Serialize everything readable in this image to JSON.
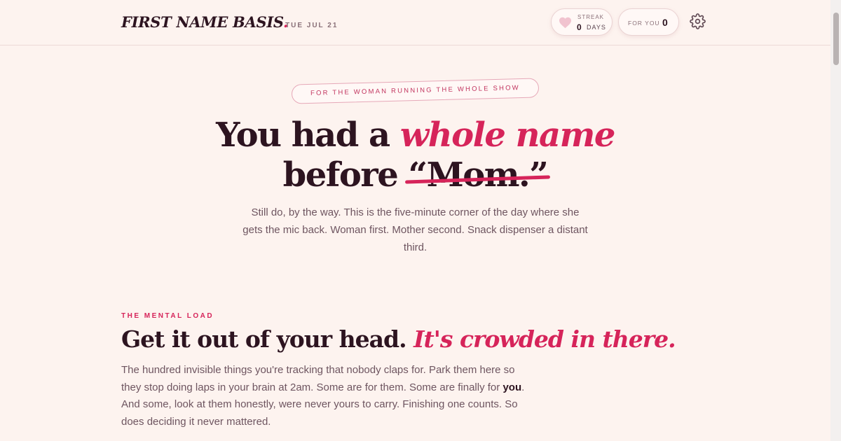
{
  "header": {
    "logo": "FIRST NAME BASIS",
    "logo_dot": ".",
    "date": "TUE JUL 21",
    "streak": {
      "label": "STREAK",
      "value": "0",
      "unit": "DAYS"
    },
    "for_you": {
      "label": "FOR YOU",
      "value": "0"
    }
  },
  "hero": {
    "tagline": "FOR THE WOMAN RUNNING THE WHOLE SHOW",
    "line1_plain": "You had a ",
    "line1_accent": "whole name",
    "line2_plain": "before ",
    "line2_struck": "“Mom.”",
    "subtitle": "Still do, by the way. This is the five-minute corner of the day where she gets the mic back. Woman first. Mother second. Snack dispenser a distant third."
  },
  "mental_load": {
    "eyebrow": "THE MENTAL LOAD",
    "title_plain": "Get it out of your head. ",
    "title_accent": "It's crowded in there.",
    "body_before": "The hundred invisible things you're tracking that nobody claps for. Park them here so they stop doing laps in your brain at 2am. Some are for them. Some are finally for ",
    "body_bold": "you",
    "body_after": ". And some, look at them honestly, were never yours to carry. Finishing one counts. So does deciding it never mattered."
  },
  "colors": {
    "accent": "#d6245a",
    "text": "#2d1420",
    "background": "#fdf3ef",
    "muted": "#6e5560"
  },
  "icons": {
    "streak": "heart-icon",
    "settings": "gear-icon"
  }
}
